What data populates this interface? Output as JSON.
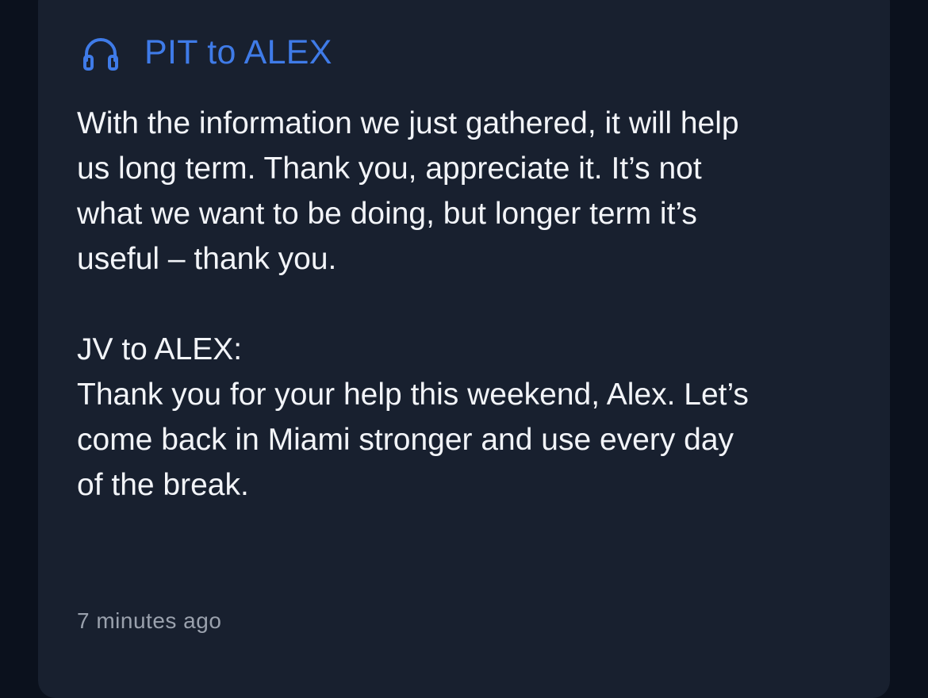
{
  "notification": {
    "icon": "headset-icon",
    "accent_color": "#3f7be8",
    "title": "PIT to ALEX",
    "body": "With the information we just gathered, it will help\nus long term. Thank you, appreciate it. It’s not\nwhat we want to be doing, but longer term it’s\nuseful – thank you.\n\nJV to ALEX:\nThank you for your help this weekend, Alex. Let’s\ncome back in Miami stronger and use every day\nof the break.",
    "timestamp": "7 minutes ago"
  }
}
